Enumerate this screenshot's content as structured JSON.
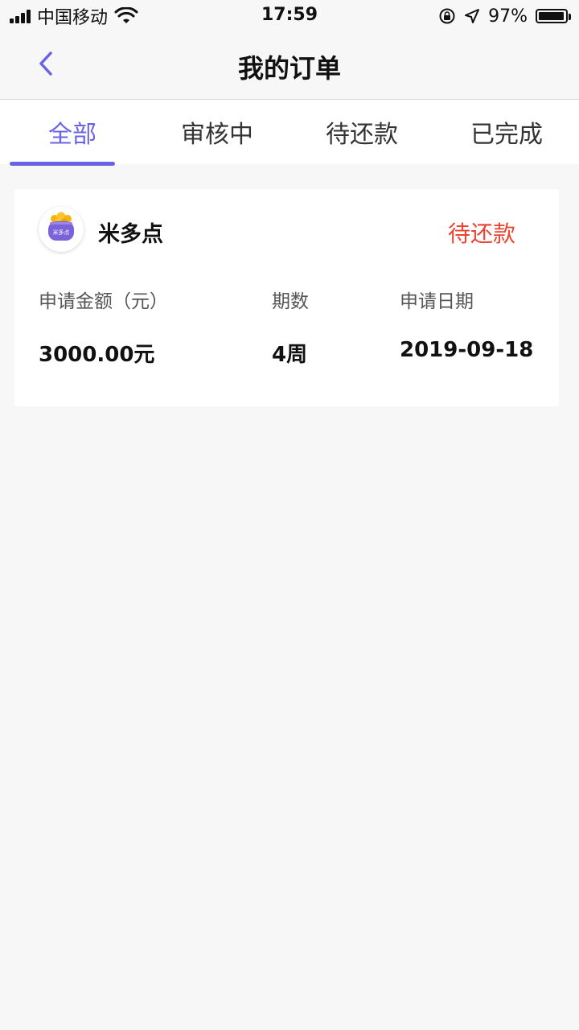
{
  "status_bar": {
    "carrier": "中国移动",
    "time": "17:59",
    "battery": "97%",
    "battery_level": 0.97
  },
  "nav": {
    "title": "我的订单"
  },
  "tabs": [
    {
      "label": "全部",
      "active": true
    },
    {
      "label": "审核中",
      "active": false
    },
    {
      "label": "待还款",
      "active": false
    },
    {
      "label": "已完成",
      "active": false
    }
  ],
  "order": {
    "merchant": "米多点",
    "logo_text": "米多点",
    "status": "待还款",
    "status_color": "#e84432",
    "fields": {
      "amount_label": "申请金额（元）",
      "amount_value": "3000.00元",
      "period_label": "期数",
      "period_value": "4周",
      "date_label": "申请日期",
      "date_value": "2019-09-18"
    }
  },
  "colors": {
    "accent": "#6b63e6",
    "background": "#f7f7f7"
  },
  "icons": [
    "signal-icon",
    "wifi-icon",
    "lock-rotation-icon",
    "location-arrow-icon",
    "battery-icon",
    "chevron-left-icon"
  ]
}
